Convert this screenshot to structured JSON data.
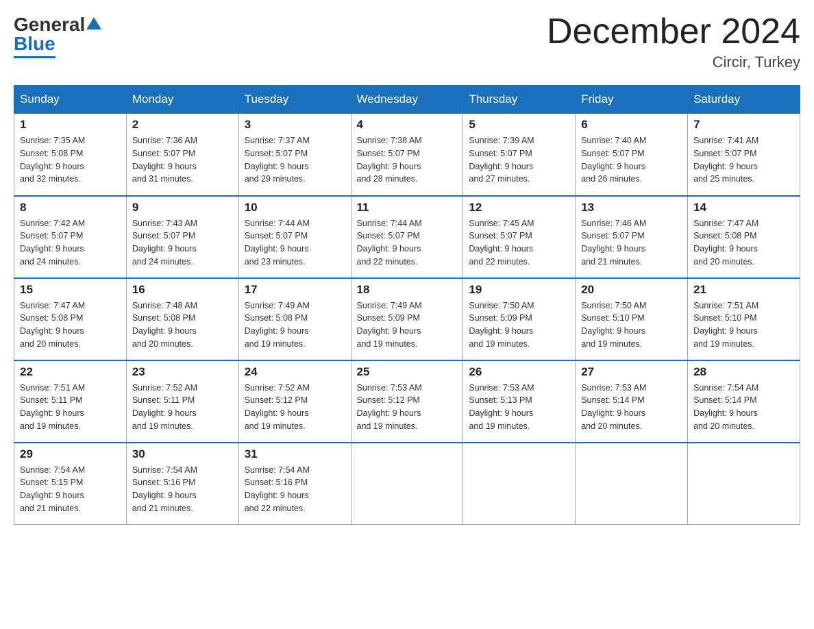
{
  "logo": {
    "general": "General",
    "blue": "Blue"
  },
  "title": "December 2024",
  "location": "Circir, Turkey",
  "days_of_week": [
    "Sunday",
    "Monday",
    "Tuesday",
    "Wednesday",
    "Thursday",
    "Friday",
    "Saturday"
  ],
  "weeks": [
    [
      {
        "day": "1",
        "sunrise": "7:35 AM",
        "sunset": "5:08 PM",
        "daylight": "9 hours and 32 minutes."
      },
      {
        "day": "2",
        "sunrise": "7:36 AM",
        "sunset": "5:07 PM",
        "daylight": "9 hours and 31 minutes."
      },
      {
        "day": "3",
        "sunrise": "7:37 AM",
        "sunset": "5:07 PM",
        "daylight": "9 hours and 29 minutes."
      },
      {
        "day": "4",
        "sunrise": "7:38 AM",
        "sunset": "5:07 PM",
        "daylight": "9 hours and 28 minutes."
      },
      {
        "day": "5",
        "sunrise": "7:39 AM",
        "sunset": "5:07 PM",
        "daylight": "9 hours and 27 minutes."
      },
      {
        "day": "6",
        "sunrise": "7:40 AM",
        "sunset": "5:07 PM",
        "daylight": "9 hours and 26 minutes."
      },
      {
        "day": "7",
        "sunrise": "7:41 AM",
        "sunset": "5:07 PM",
        "daylight": "9 hours and 25 minutes."
      }
    ],
    [
      {
        "day": "8",
        "sunrise": "7:42 AM",
        "sunset": "5:07 PM",
        "daylight": "9 hours and 24 minutes."
      },
      {
        "day": "9",
        "sunrise": "7:43 AM",
        "sunset": "5:07 PM",
        "daylight": "9 hours and 24 minutes."
      },
      {
        "day": "10",
        "sunrise": "7:44 AM",
        "sunset": "5:07 PM",
        "daylight": "9 hours and 23 minutes."
      },
      {
        "day": "11",
        "sunrise": "7:44 AM",
        "sunset": "5:07 PM",
        "daylight": "9 hours and 22 minutes."
      },
      {
        "day": "12",
        "sunrise": "7:45 AM",
        "sunset": "5:07 PM",
        "daylight": "9 hours and 22 minutes."
      },
      {
        "day": "13",
        "sunrise": "7:46 AM",
        "sunset": "5:07 PM",
        "daylight": "9 hours and 21 minutes."
      },
      {
        "day": "14",
        "sunrise": "7:47 AM",
        "sunset": "5:08 PM",
        "daylight": "9 hours and 20 minutes."
      }
    ],
    [
      {
        "day": "15",
        "sunrise": "7:47 AM",
        "sunset": "5:08 PM",
        "daylight": "9 hours and 20 minutes."
      },
      {
        "day": "16",
        "sunrise": "7:48 AM",
        "sunset": "5:08 PM",
        "daylight": "9 hours and 20 minutes."
      },
      {
        "day": "17",
        "sunrise": "7:49 AM",
        "sunset": "5:08 PM",
        "daylight": "9 hours and 19 minutes."
      },
      {
        "day": "18",
        "sunrise": "7:49 AM",
        "sunset": "5:09 PM",
        "daylight": "9 hours and 19 minutes."
      },
      {
        "day": "19",
        "sunrise": "7:50 AM",
        "sunset": "5:09 PM",
        "daylight": "9 hours and 19 minutes."
      },
      {
        "day": "20",
        "sunrise": "7:50 AM",
        "sunset": "5:10 PM",
        "daylight": "9 hours and 19 minutes."
      },
      {
        "day": "21",
        "sunrise": "7:51 AM",
        "sunset": "5:10 PM",
        "daylight": "9 hours and 19 minutes."
      }
    ],
    [
      {
        "day": "22",
        "sunrise": "7:51 AM",
        "sunset": "5:11 PM",
        "daylight": "9 hours and 19 minutes."
      },
      {
        "day": "23",
        "sunrise": "7:52 AM",
        "sunset": "5:11 PM",
        "daylight": "9 hours and 19 minutes."
      },
      {
        "day": "24",
        "sunrise": "7:52 AM",
        "sunset": "5:12 PM",
        "daylight": "9 hours and 19 minutes."
      },
      {
        "day": "25",
        "sunrise": "7:53 AM",
        "sunset": "5:12 PM",
        "daylight": "9 hours and 19 minutes."
      },
      {
        "day": "26",
        "sunrise": "7:53 AM",
        "sunset": "5:13 PM",
        "daylight": "9 hours and 19 minutes."
      },
      {
        "day": "27",
        "sunrise": "7:53 AM",
        "sunset": "5:14 PM",
        "daylight": "9 hours and 20 minutes."
      },
      {
        "day": "28",
        "sunrise": "7:54 AM",
        "sunset": "5:14 PM",
        "daylight": "9 hours and 20 minutes."
      }
    ],
    [
      {
        "day": "29",
        "sunrise": "7:54 AM",
        "sunset": "5:15 PM",
        "daylight": "9 hours and 21 minutes."
      },
      {
        "day": "30",
        "sunrise": "7:54 AM",
        "sunset": "5:16 PM",
        "daylight": "9 hours and 21 minutes."
      },
      {
        "day": "31",
        "sunrise": "7:54 AM",
        "sunset": "5:16 PM",
        "daylight": "9 hours and 22 minutes."
      },
      null,
      null,
      null,
      null
    ]
  ],
  "labels": {
    "sunrise": "Sunrise:",
    "sunset": "Sunset:",
    "daylight": "Daylight:"
  }
}
